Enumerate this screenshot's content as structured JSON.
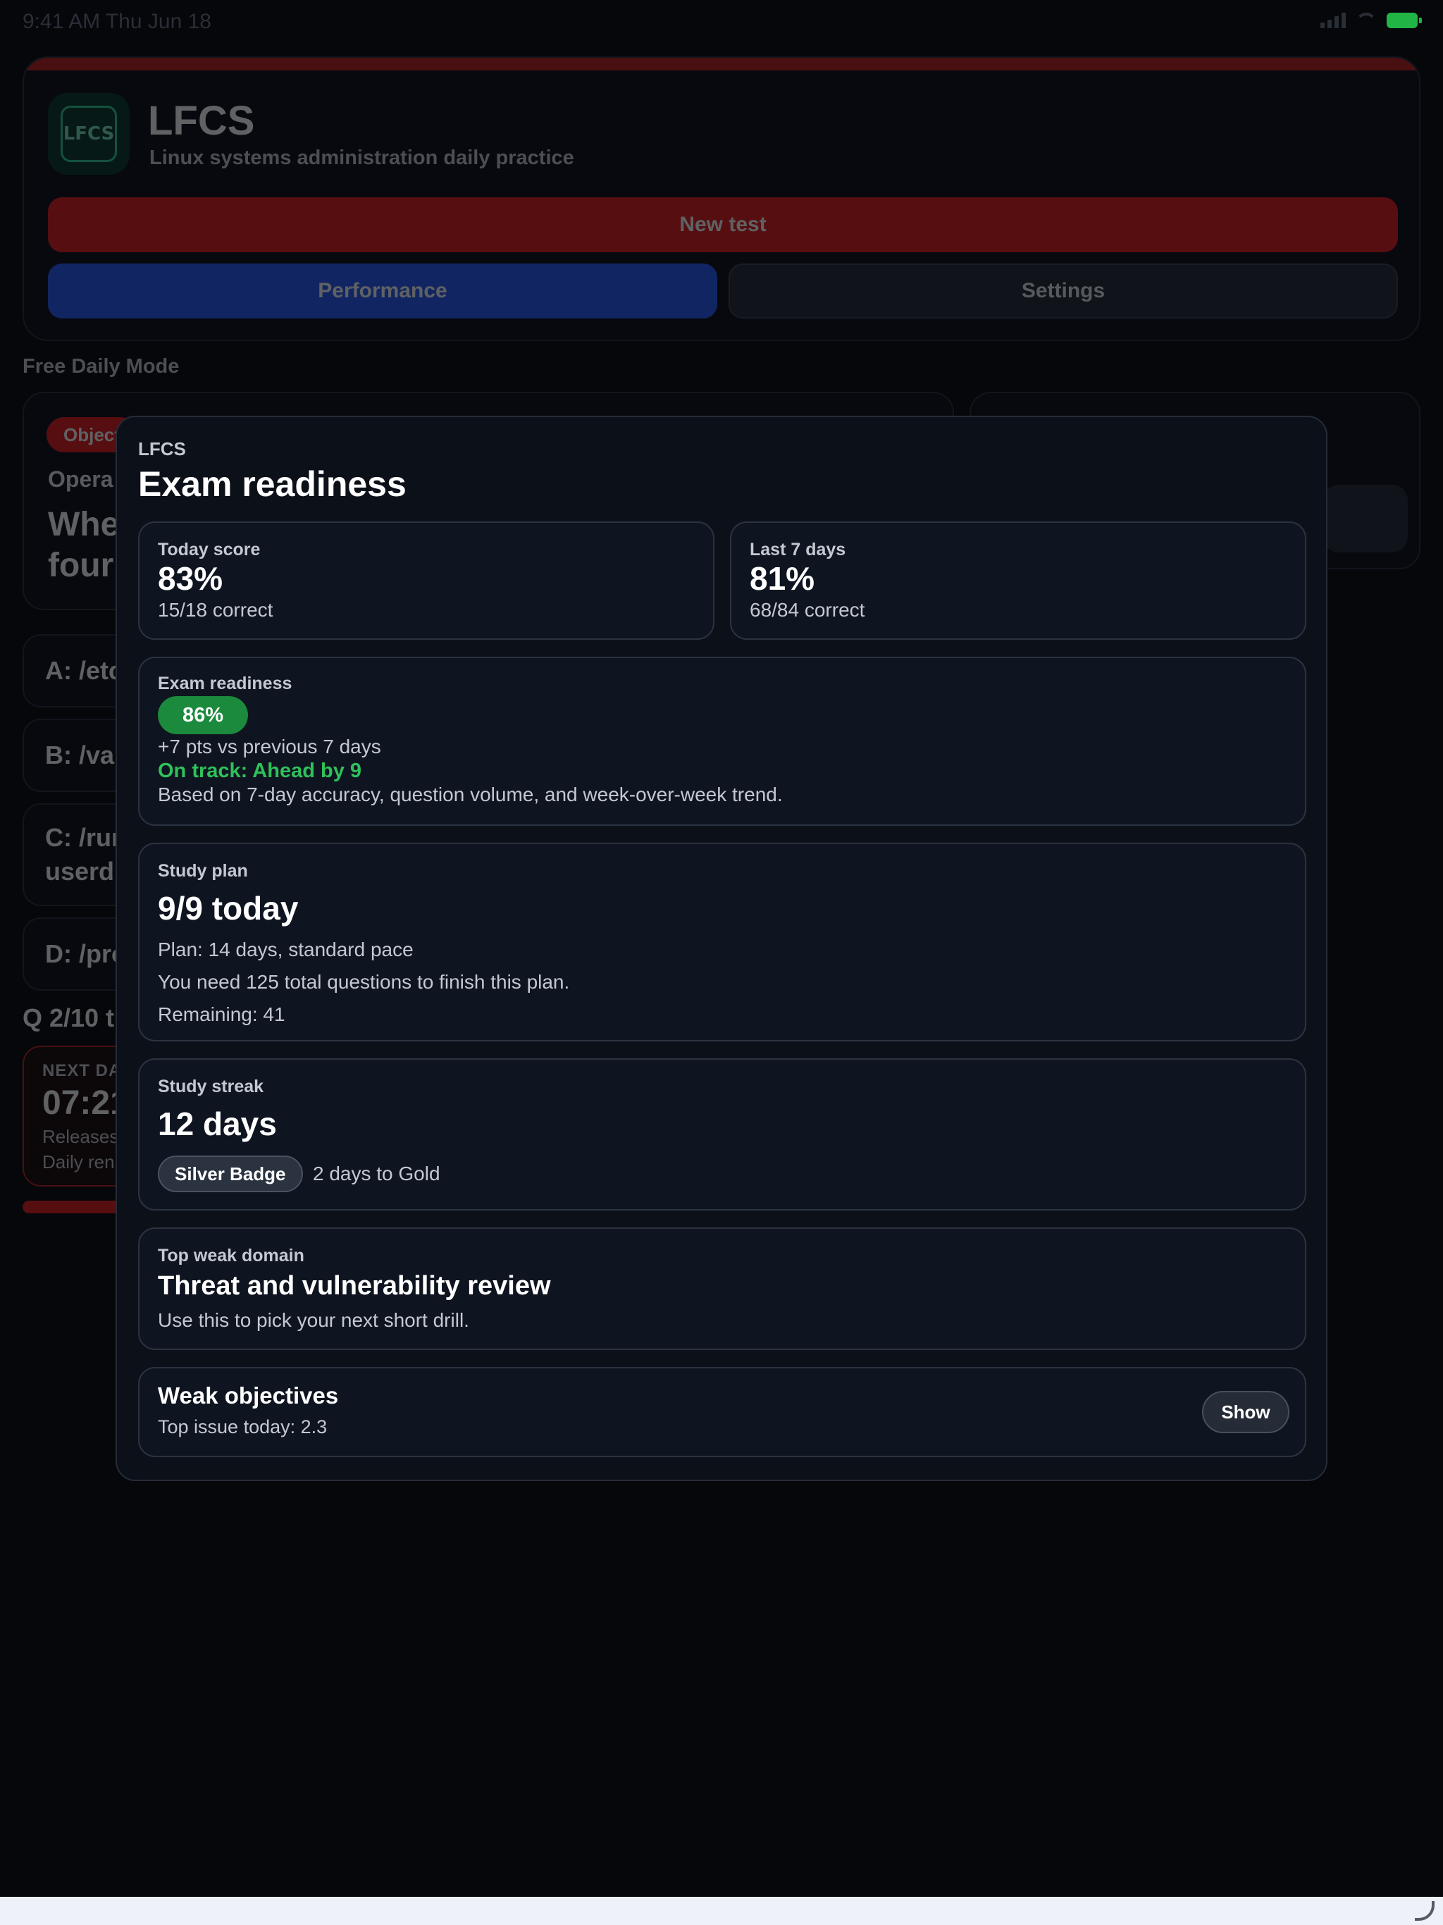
{
  "status_bar": {
    "time": "9:41 AM  Thu Jun 18"
  },
  "header": {
    "icon_text": "LFCS",
    "title": "LFCS",
    "subtitle": "Linux systems administration daily practice",
    "new_test_label": "New test",
    "performance_label": "Performance",
    "settings_label": "Settings"
  },
  "mode_label": "Free Daily Mode",
  "question": {
    "objective_pill": "Object",
    "subtitle": "Opera",
    "text_line1": "Whe",
    "text_line2": "four"
  },
  "answers": [
    {
      "label": "A: /etc"
    },
    {
      "label": "B: /var"
    },
    {
      "label": "C: /run",
      "line2": "userd"
    },
    {
      "label": "D: /pro"
    }
  ],
  "progress_text": "Q 2/10 t",
  "next_daily": {
    "label": "NEXT DAI",
    "time": "07:21",
    "line1": "Releases",
    "line2": "Daily ren"
  },
  "modal": {
    "eyebrow": "LFCS",
    "title": "Exam readiness",
    "today": {
      "label": "Today score",
      "value": "83%",
      "detail": "15/18 correct"
    },
    "last7": {
      "label": "Last 7 days",
      "value": "81%",
      "detail": "68/84 correct"
    },
    "readiness": {
      "label": "Exam readiness",
      "value": "86%",
      "change": "+7 pts vs previous 7 days",
      "status": "On track: Ahead by 9",
      "basis": "Based on 7-day accuracy, question volume, and week-over-week trend."
    },
    "plan": {
      "label": "Study plan",
      "value": "9/9 today",
      "line1": "Plan: 14 days, standard pace",
      "line2": "You need 125 total questions to finish this plan.",
      "line3": "Remaining: 41"
    },
    "streak": {
      "label": "Study streak",
      "value": "12 days",
      "badge": "Silver Badge",
      "next": "2 days to Gold"
    },
    "weak_domain": {
      "label": "Top weak domain",
      "value": "Threat and vulnerability review",
      "hint": "Use this to pick your next short drill."
    },
    "weak_objectives": {
      "title": "Weak objectives",
      "subtitle": "Top issue today: 2.3",
      "button": "Show"
    }
  },
  "colors": {
    "background": "#05070b",
    "accent_red": "#e61d1d",
    "accent_blue": "#2a5bff",
    "success_green": "#2fc15a",
    "readiness_pill": "#1b8a3c"
  }
}
